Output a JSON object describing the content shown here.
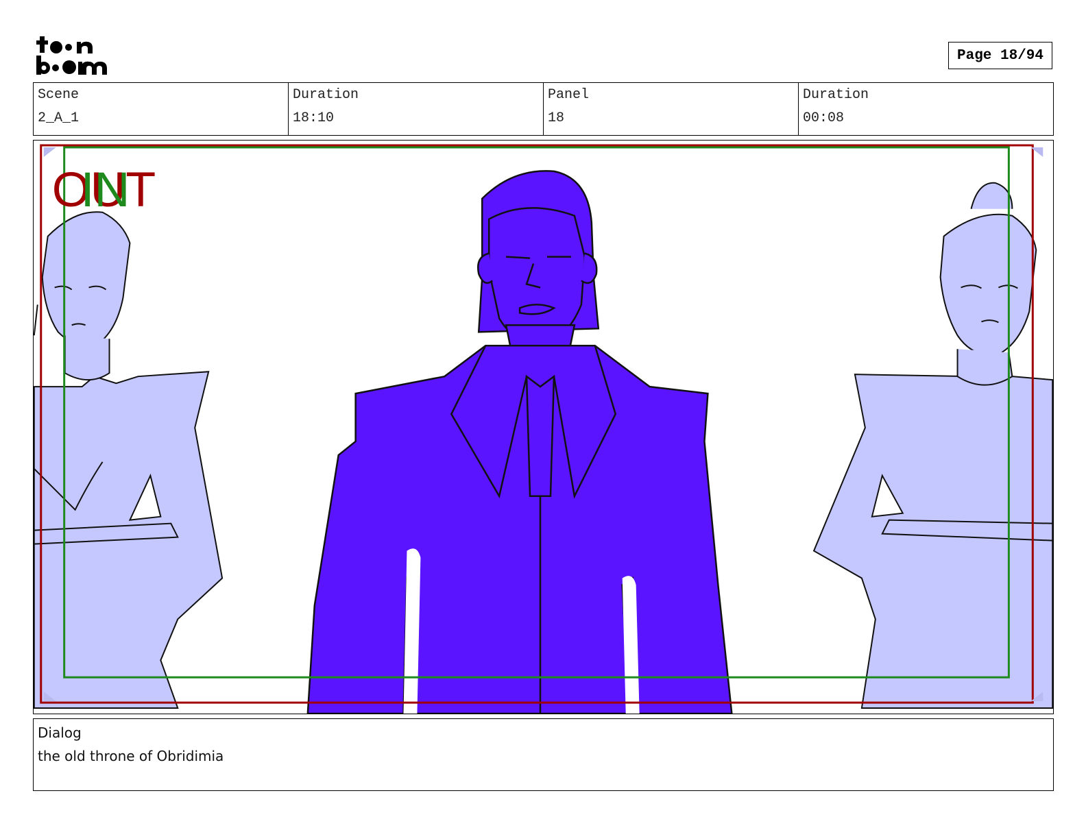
{
  "logo": {
    "line1": "toon",
    "line2": "boom"
  },
  "page": {
    "label": "Page 18/94"
  },
  "info": {
    "scene_label": "Scene",
    "scene_value": "2_A_1",
    "duration_label": "Duration",
    "duration_value": "18:10",
    "panel_label": "Panel",
    "panel_value": "18",
    "panel_duration_label": "Duration",
    "panel_duration_value": "00:08"
  },
  "frame": {
    "out_label": "OUT",
    "in_label": "IN",
    "out_color": "#a00000",
    "in_color": "#1e8a1e",
    "main_figure_color": "#5a14ff",
    "side_figure_color": "#c5c7ff"
  },
  "dialog": {
    "label": "Dialog",
    "text": "the old throne of Obridimia"
  }
}
